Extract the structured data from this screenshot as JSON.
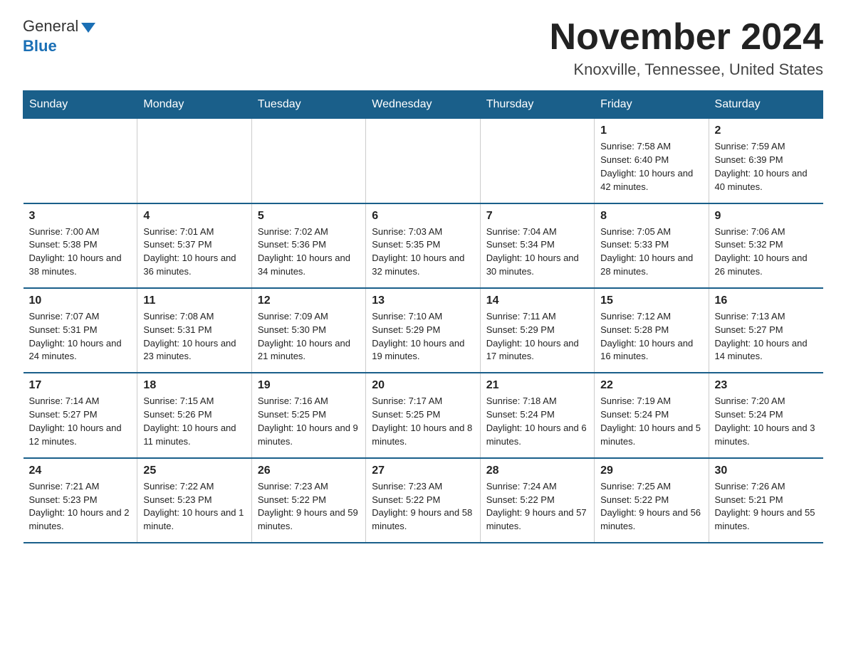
{
  "header": {
    "logo_general": "General",
    "logo_blue": "Blue",
    "title": "November 2024",
    "subtitle": "Knoxville, Tennessee, United States"
  },
  "days_of_week": [
    "Sunday",
    "Monday",
    "Tuesday",
    "Wednesday",
    "Thursday",
    "Friday",
    "Saturday"
  ],
  "weeks": [
    {
      "days": [
        {
          "num": "",
          "info": ""
        },
        {
          "num": "",
          "info": ""
        },
        {
          "num": "",
          "info": ""
        },
        {
          "num": "",
          "info": ""
        },
        {
          "num": "",
          "info": ""
        },
        {
          "num": "1",
          "info": "Sunrise: 7:58 AM\nSunset: 6:40 PM\nDaylight: 10 hours and 42 minutes."
        },
        {
          "num": "2",
          "info": "Sunrise: 7:59 AM\nSunset: 6:39 PM\nDaylight: 10 hours and 40 minutes."
        }
      ]
    },
    {
      "days": [
        {
          "num": "3",
          "info": "Sunrise: 7:00 AM\nSunset: 5:38 PM\nDaylight: 10 hours and 38 minutes."
        },
        {
          "num": "4",
          "info": "Sunrise: 7:01 AM\nSunset: 5:37 PM\nDaylight: 10 hours and 36 minutes."
        },
        {
          "num": "5",
          "info": "Sunrise: 7:02 AM\nSunset: 5:36 PM\nDaylight: 10 hours and 34 minutes."
        },
        {
          "num": "6",
          "info": "Sunrise: 7:03 AM\nSunset: 5:35 PM\nDaylight: 10 hours and 32 minutes."
        },
        {
          "num": "7",
          "info": "Sunrise: 7:04 AM\nSunset: 5:34 PM\nDaylight: 10 hours and 30 minutes."
        },
        {
          "num": "8",
          "info": "Sunrise: 7:05 AM\nSunset: 5:33 PM\nDaylight: 10 hours and 28 minutes."
        },
        {
          "num": "9",
          "info": "Sunrise: 7:06 AM\nSunset: 5:32 PM\nDaylight: 10 hours and 26 minutes."
        }
      ]
    },
    {
      "days": [
        {
          "num": "10",
          "info": "Sunrise: 7:07 AM\nSunset: 5:31 PM\nDaylight: 10 hours and 24 minutes."
        },
        {
          "num": "11",
          "info": "Sunrise: 7:08 AM\nSunset: 5:31 PM\nDaylight: 10 hours and 23 minutes."
        },
        {
          "num": "12",
          "info": "Sunrise: 7:09 AM\nSunset: 5:30 PM\nDaylight: 10 hours and 21 minutes."
        },
        {
          "num": "13",
          "info": "Sunrise: 7:10 AM\nSunset: 5:29 PM\nDaylight: 10 hours and 19 minutes."
        },
        {
          "num": "14",
          "info": "Sunrise: 7:11 AM\nSunset: 5:29 PM\nDaylight: 10 hours and 17 minutes."
        },
        {
          "num": "15",
          "info": "Sunrise: 7:12 AM\nSunset: 5:28 PM\nDaylight: 10 hours and 16 minutes."
        },
        {
          "num": "16",
          "info": "Sunrise: 7:13 AM\nSunset: 5:27 PM\nDaylight: 10 hours and 14 minutes."
        }
      ]
    },
    {
      "days": [
        {
          "num": "17",
          "info": "Sunrise: 7:14 AM\nSunset: 5:27 PM\nDaylight: 10 hours and 12 minutes."
        },
        {
          "num": "18",
          "info": "Sunrise: 7:15 AM\nSunset: 5:26 PM\nDaylight: 10 hours and 11 minutes."
        },
        {
          "num": "19",
          "info": "Sunrise: 7:16 AM\nSunset: 5:25 PM\nDaylight: 10 hours and 9 minutes."
        },
        {
          "num": "20",
          "info": "Sunrise: 7:17 AM\nSunset: 5:25 PM\nDaylight: 10 hours and 8 minutes."
        },
        {
          "num": "21",
          "info": "Sunrise: 7:18 AM\nSunset: 5:24 PM\nDaylight: 10 hours and 6 minutes."
        },
        {
          "num": "22",
          "info": "Sunrise: 7:19 AM\nSunset: 5:24 PM\nDaylight: 10 hours and 5 minutes."
        },
        {
          "num": "23",
          "info": "Sunrise: 7:20 AM\nSunset: 5:24 PM\nDaylight: 10 hours and 3 minutes."
        }
      ]
    },
    {
      "days": [
        {
          "num": "24",
          "info": "Sunrise: 7:21 AM\nSunset: 5:23 PM\nDaylight: 10 hours and 2 minutes."
        },
        {
          "num": "25",
          "info": "Sunrise: 7:22 AM\nSunset: 5:23 PM\nDaylight: 10 hours and 1 minute."
        },
        {
          "num": "26",
          "info": "Sunrise: 7:23 AM\nSunset: 5:22 PM\nDaylight: 9 hours and 59 minutes."
        },
        {
          "num": "27",
          "info": "Sunrise: 7:23 AM\nSunset: 5:22 PM\nDaylight: 9 hours and 58 minutes."
        },
        {
          "num": "28",
          "info": "Sunrise: 7:24 AM\nSunset: 5:22 PM\nDaylight: 9 hours and 57 minutes."
        },
        {
          "num": "29",
          "info": "Sunrise: 7:25 AM\nSunset: 5:22 PM\nDaylight: 9 hours and 56 minutes."
        },
        {
          "num": "30",
          "info": "Sunrise: 7:26 AM\nSunset: 5:21 PM\nDaylight: 9 hours and 55 minutes."
        }
      ]
    }
  ]
}
